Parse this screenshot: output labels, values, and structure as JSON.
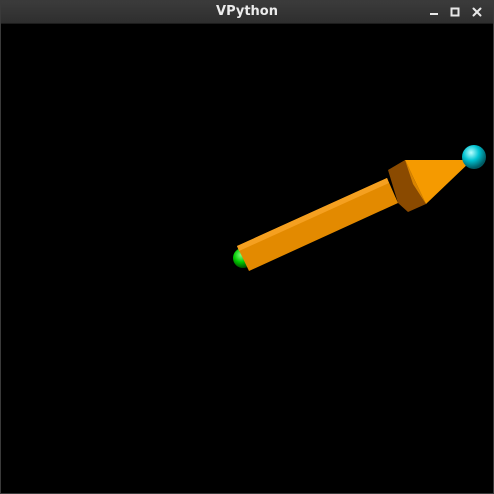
{
  "window": {
    "title": "VPython"
  },
  "icons": {
    "minimize": "minimize-icon",
    "maximize": "maximize-icon",
    "close": "close-icon"
  },
  "scene": {
    "background": "#000000",
    "arrow_color": "#f59a00",
    "tail_sphere_color": "#00d000",
    "head_sphere_color": "#00c8d8"
  }
}
